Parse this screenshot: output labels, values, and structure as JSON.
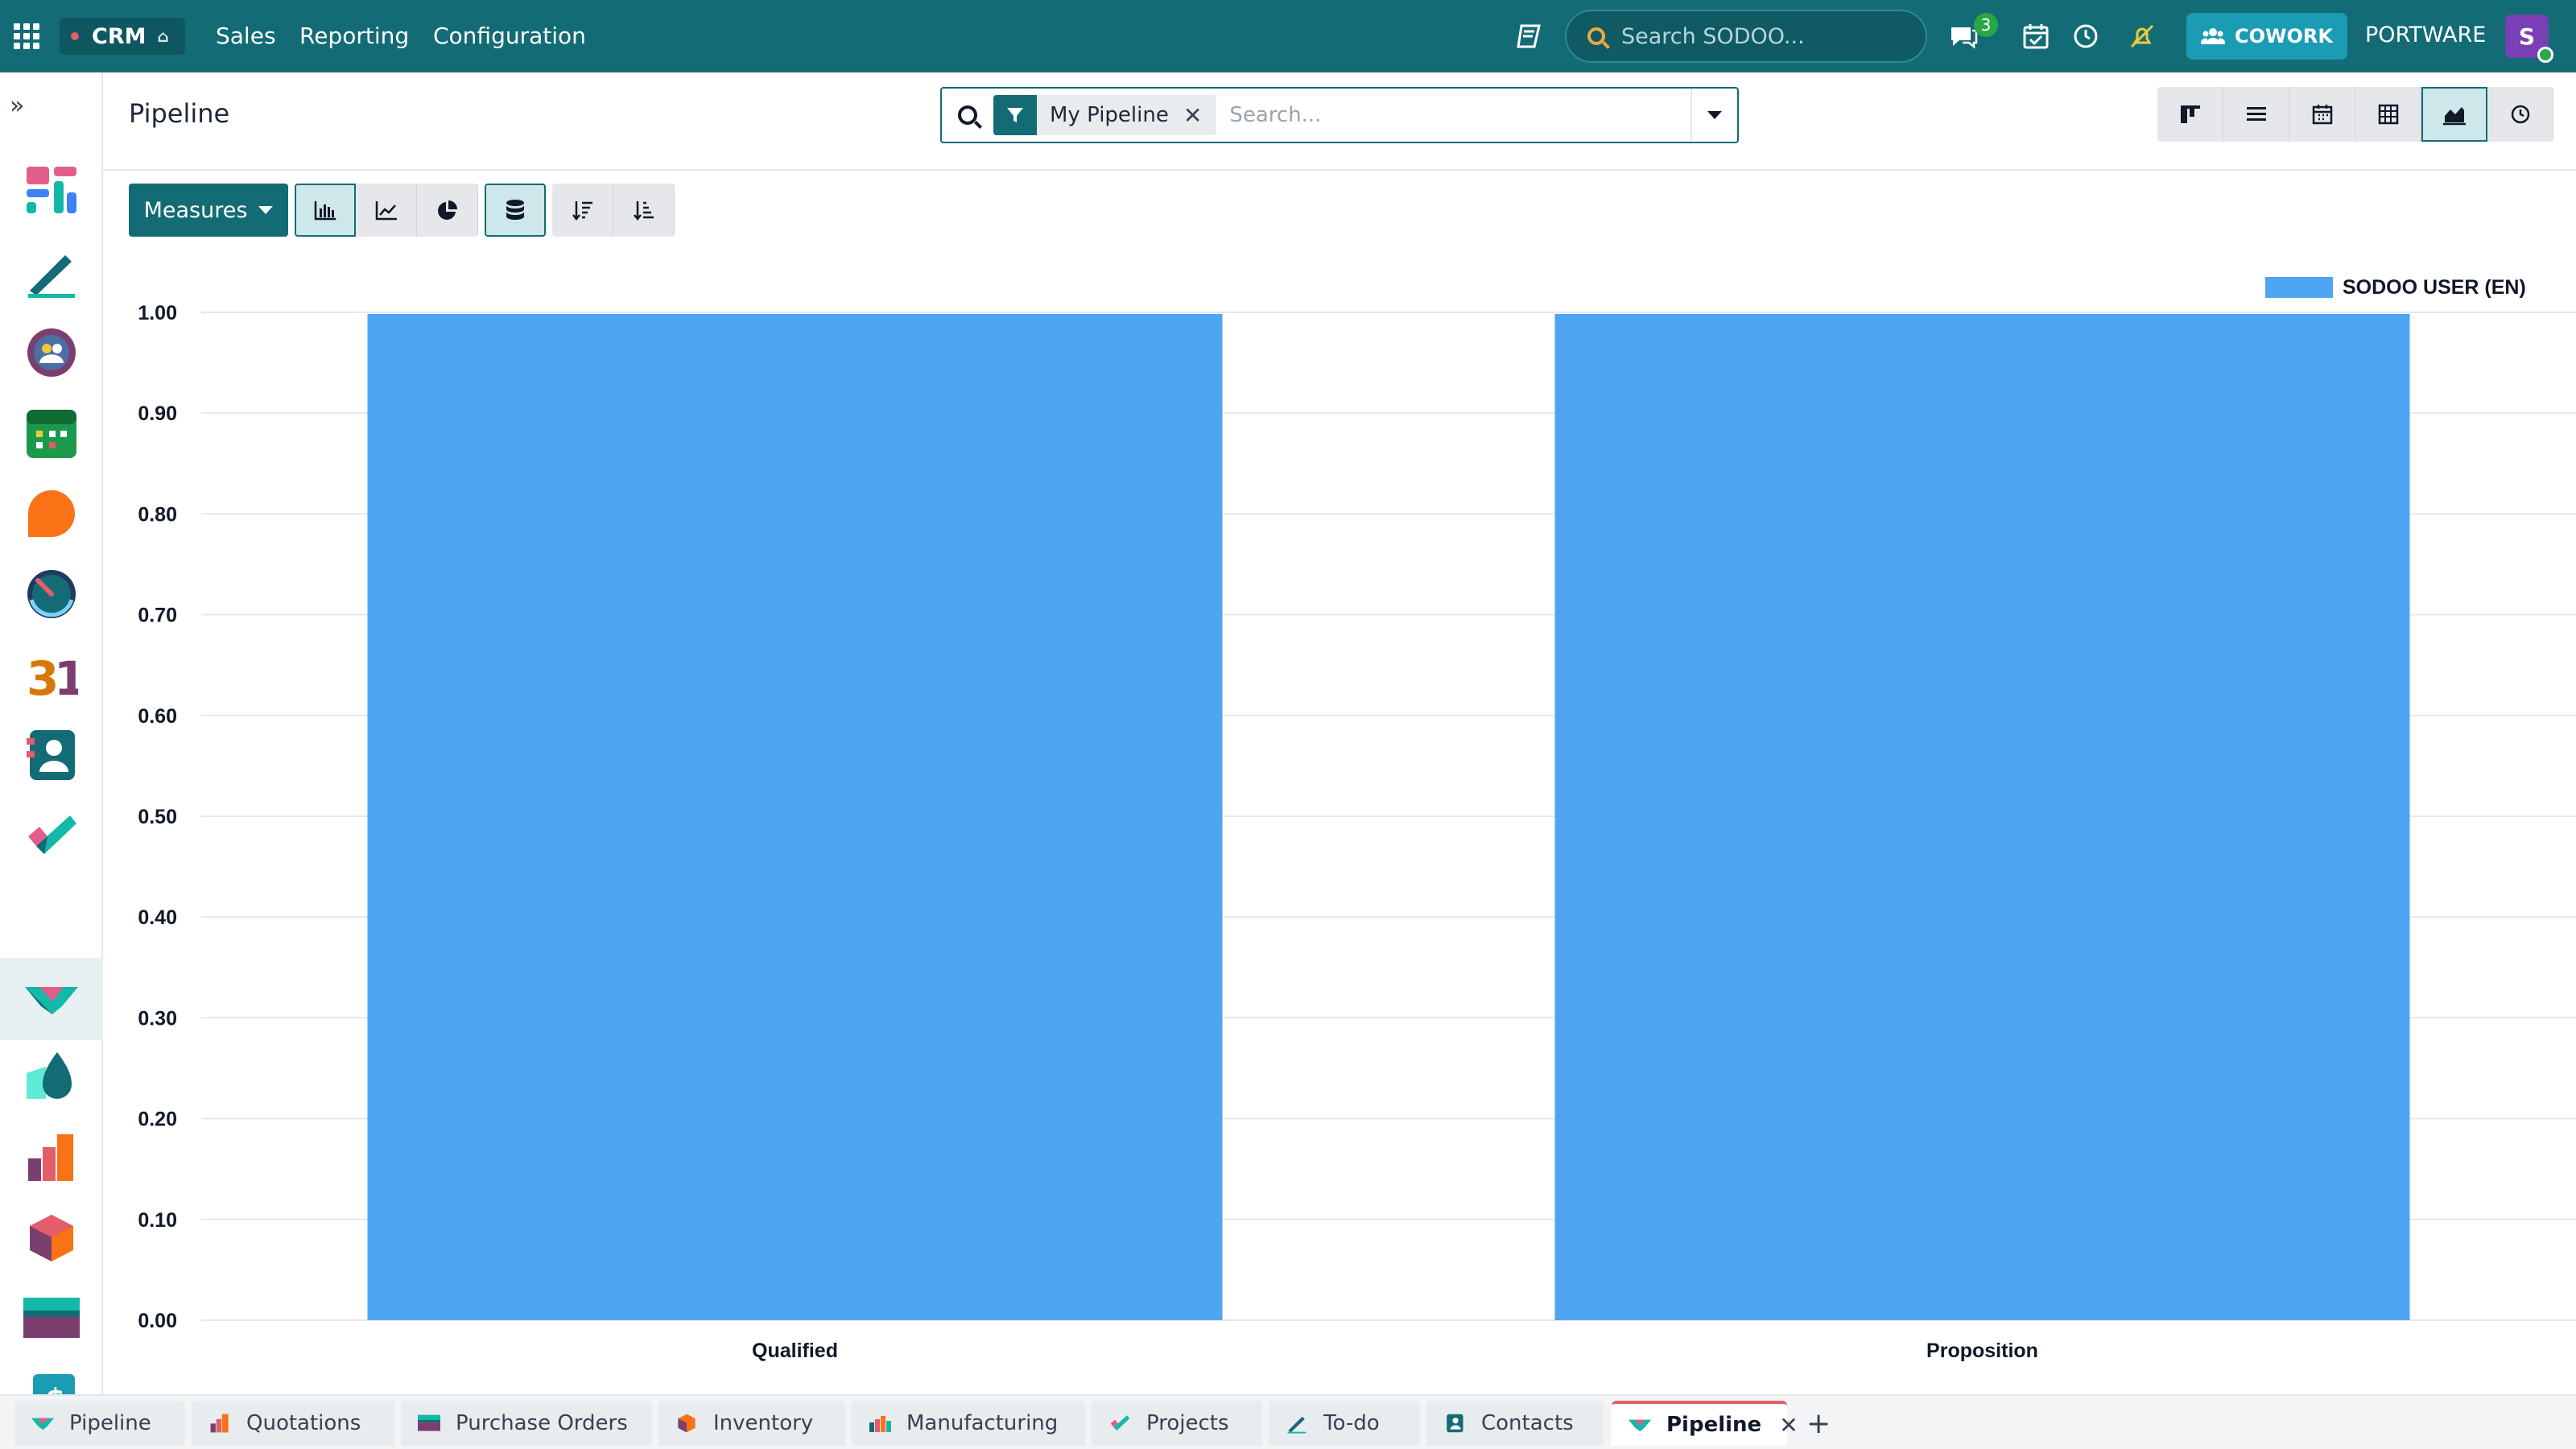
{
  "topbar": {
    "app_name": "CRM",
    "nav": [
      "Sales",
      "Reporting",
      "Configuration"
    ],
    "search_placeholder": "Search SODOO...",
    "messages_badge": "3",
    "cowork_label": "COWORK",
    "company": "PORTWARE",
    "avatar_initial": "S"
  },
  "control": {
    "page_title": "Pipeline",
    "facet_label": "My Pipeline",
    "search_placeholder": "Search..."
  },
  "toolbar": {
    "measures_label": "Measures"
  },
  "colors": {
    "brand": "#136b75",
    "bar": "#4ea5f2"
  },
  "chart_data": {
    "type": "bar",
    "categories": [
      "Qualified",
      "Proposition"
    ],
    "series": [
      {
        "name": "SODOO USER (EN)",
        "values": [
          1.0,
          1.0
        ]
      }
    ],
    "ylim": [
      0,
      1
    ],
    "yticks": [
      "0.00",
      "0.10",
      "0.20",
      "0.30",
      "0.40",
      "0.50",
      "0.60",
      "0.70",
      "0.80",
      "0.90",
      "1.00"
    ],
    "grid": true,
    "legend": "top-right"
  },
  "tabs": [
    {
      "label": "Pipeline",
      "icon": "crm-icon"
    },
    {
      "label": "Quotations",
      "icon": "sales-icon"
    },
    {
      "label": "Purchase Orders",
      "icon": "purchase-icon"
    },
    {
      "label": "Inventory",
      "icon": "inventory-icon"
    },
    {
      "label": "Manufacturing",
      "icon": "manufacturing-icon"
    },
    {
      "label": "Projects",
      "icon": "projects-icon"
    },
    {
      "label": "To-do",
      "icon": "todo-icon"
    },
    {
      "label": "Contacts",
      "icon": "contacts-icon"
    },
    {
      "label": "Pipeline",
      "icon": "crm-icon",
      "active": true
    }
  ]
}
